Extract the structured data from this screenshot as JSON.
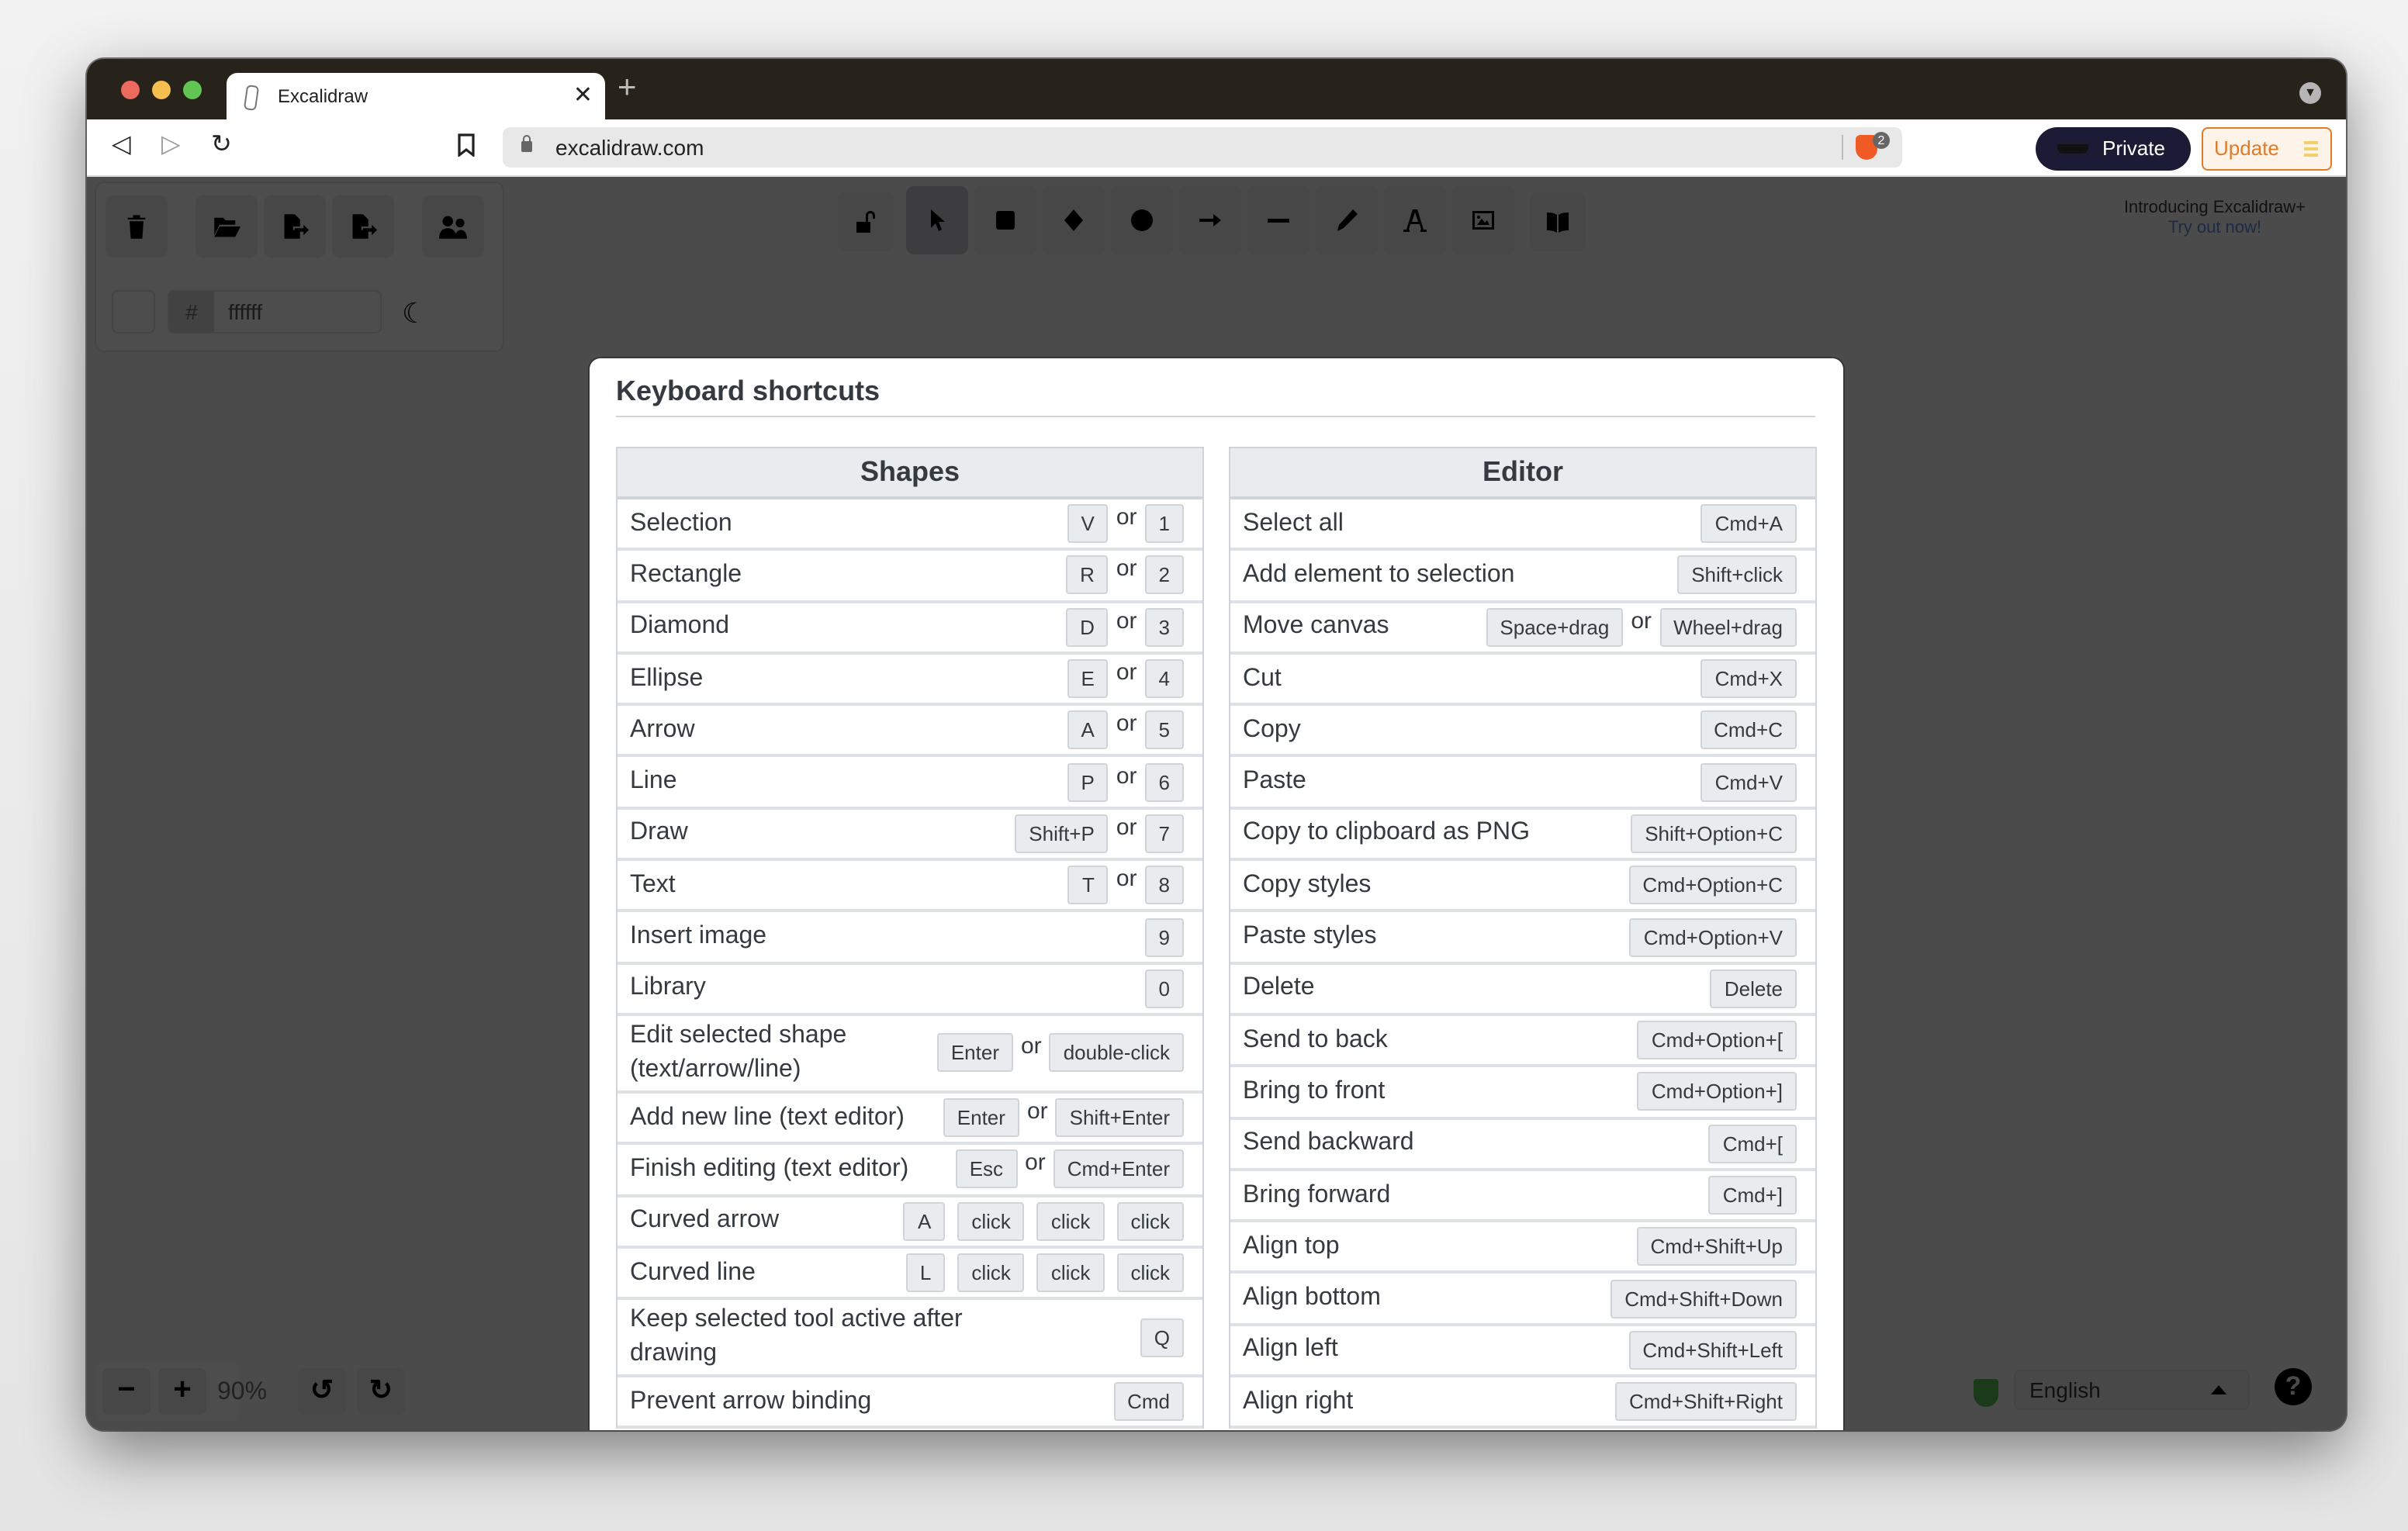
{
  "browser": {
    "tab_title": "Excalidraw",
    "new_tab_label": "+",
    "url": "excalidraw.com",
    "shields_count": "2",
    "private_label": "Private",
    "update_label": "Update"
  },
  "app": {
    "canvas_background_hex": "ffffff",
    "hash_label": "#",
    "promo": {
      "line1": "Introducing Excalidraw+",
      "link": "Try out now!"
    },
    "zoom_level": "90%",
    "language": "English",
    "help_label": "?",
    "left_panel_icons": [
      "trash-icon",
      "folder-open-icon",
      "export-file-icon",
      "export-image-icon",
      "collaborators-icon"
    ],
    "tools": [
      {
        "name": "lock",
        "shortcut": ""
      },
      {
        "name": "selection",
        "shortcut": "1"
      },
      {
        "name": "rectangle",
        "shortcut": "2"
      },
      {
        "name": "diamond",
        "shortcut": "3"
      },
      {
        "name": "ellipse",
        "shortcut": "4"
      },
      {
        "name": "arrow",
        "shortcut": "5"
      },
      {
        "name": "line",
        "shortcut": "6"
      },
      {
        "name": "draw",
        "shortcut": "7"
      },
      {
        "name": "text",
        "shortcut": "8"
      },
      {
        "name": "image",
        "shortcut": "9"
      },
      {
        "name": "library",
        "shortcut": ""
      }
    ]
  },
  "dialog": {
    "title": "Keyboard shortcuts",
    "or_label": "or",
    "shapes": {
      "heading": "Shapes",
      "rows": [
        {
          "label": "Selection",
          "keys": [
            "V",
            "1"
          ],
          "sep": "or"
        },
        {
          "label": "Rectangle",
          "keys": [
            "R",
            "2"
          ],
          "sep": "or"
        },
        {
          "label": "Diamond",
          "keys": [
            "D",
            "3"
          ],
          "sep": "or"
        },
        {
          "label": "Ellipse",
          "keys": [
            "E",
            "4"
          ],
          "sep": "or"
        },
        {
          "label": "Arrow",
          "keys": [
            "A",
            "5"
          ],
          "sep": "or"
        },
        {
          "label": "Line",
          "keys": [
            "P",
            "6"
          ],
          "sep": "or"
        },
        {
          "label": "Draw",
          "keys": [
            "Shift+P",
            "7"
          ],
          "sep": "or"
        },
        {
          "label": "Text",
          "keys": [
            "T",
            "8"
          ],
          "sep": "or"
        },
        {
          "label": "Insert image",
          "keys": [
            "9"
          ],
          "sep": ""
        },
        {
          "label": "Library",
          "keys": [
            "0"
          ],
          "sep": ""
        },
        {
          "label": "Edit selected shape (text/arrow/line)",
          "keys": [
            "Enter",
            "double-click"
          ],
          "sep": "or",
          "tall": true
        },
        {
          "label": "Add new line (text editor)",
          "keys": [
            "Enter",
            "Shift+Enter"
          ],
          "sep": "or"
        },
        {
          "label": "Finish editing (text editor)",
          "keys": [
            "Esc",
            "Cmd+Enter"
          ],
          "sep": "or"
        },
        {
          "label": "Curved arrow",
          "keys": [
            "A",
            "click",
            "click",
            "click"
          ],
          "sep": ""
        },
        {
          "label": "Curved line",
          "keys": [
            "L",
            "click",
            "click",
            "click"
          ],
          "sep": ""
        },
        {
          "label": "Keep selected tool active after drawing",
          "keys": [
            "Q"
          ],
          "sep": "",
          "tall": true
        },
        {
          "label": "Prevent arrow binding",
          "keys": [
            "Cmd"
          ],
          "sep": ""
        }
      ]
    },
    "editor": {
      "heading": "Editor",
      "rows": [
        {
          "label": "Select all",
          "keys": [
            "Cmd+A"
          ],
          "sep": ""
        },
        {
          "label": "Add element to selection",
          "keys": [
            "Shift+click"
          ],
          "sep": ""
        },
        {
          "label": "Move canvas",
          "keys": [
            "Space+drag",
            "Wheel+drag"
          ],
          "sep": "or"
        },
        {
          "label": "Cut",
          "keys": [
            "Cmd+X"
          ],
          "sep": ""
        },
        {
          "label": "Copy",
          "keys": [
            "Cmd+C"
          ],
          "sep": ""
        },
        {
          "label": "Paste",
          "keys": [
            "Cmd+V"
          ],
          "sep": ""
        },
        {
          "label": "Copy to clipboard as PNG",
          "keys": [
            "Shift+Option+C"
          ],
          "sep": ""
        },
        {
          "label": "Copy styles",
          "keys": [
            "Cmd+Option+C"
          ],
          "sep": ""
        },
        {
          "label": "Paste styles",
          "keys": [
            "Cmd+Option+V"
          ],
          "sep": ""
        },
        {
          "label": "Delete",
          "keys": [
            "Delete"
          ],
          "sep": ""
        },
        {
          "label": "Send to back",
          "keys": [
            "Cmd+Option+["
          ],
          "sep": ""
        },
        {
          "label": "Bring to front",
          "keys": [
            "Cmd+Option+]"
          ],
          "sep": ""
        },
        {
          "label": "Send backward",
          "keys": [
            "Cmd+["
          ],
          "sep": ""
        },
        {
          "label": "Bring forward",
          "keys": [
            "Cmd+]"
          ],
          "sep": ""
        },
        {
          "label": "Align top",
          "keys": [
            "Cmd+Shift+Up"
          ],
          "sep": ""
        },
        {
          "label": "Align bottom",
          "keys": [
            "Cmd+Shift+Down"
          ],
          "sep": ""
        },
        {
          "label": "Align left",
          "keys": [
            "Cmd+Shift+Left"
          ],
          "sep": ""
        },
        {
          "label": "Align right",
          "keys": [
            "Cmd+Shift+Right"
          ],
          "sep": ""
        }
      ]
    }
  },
  "colors": {
    "tabbar": "#27231a",
    "overlay": "#4b4b4b",
    "private_bg": "#1b1b35",
    "update_accent": "#e07b28",
    "kbd_bg": "#e9ecef",
    "text": "#343a40"
  }
}
